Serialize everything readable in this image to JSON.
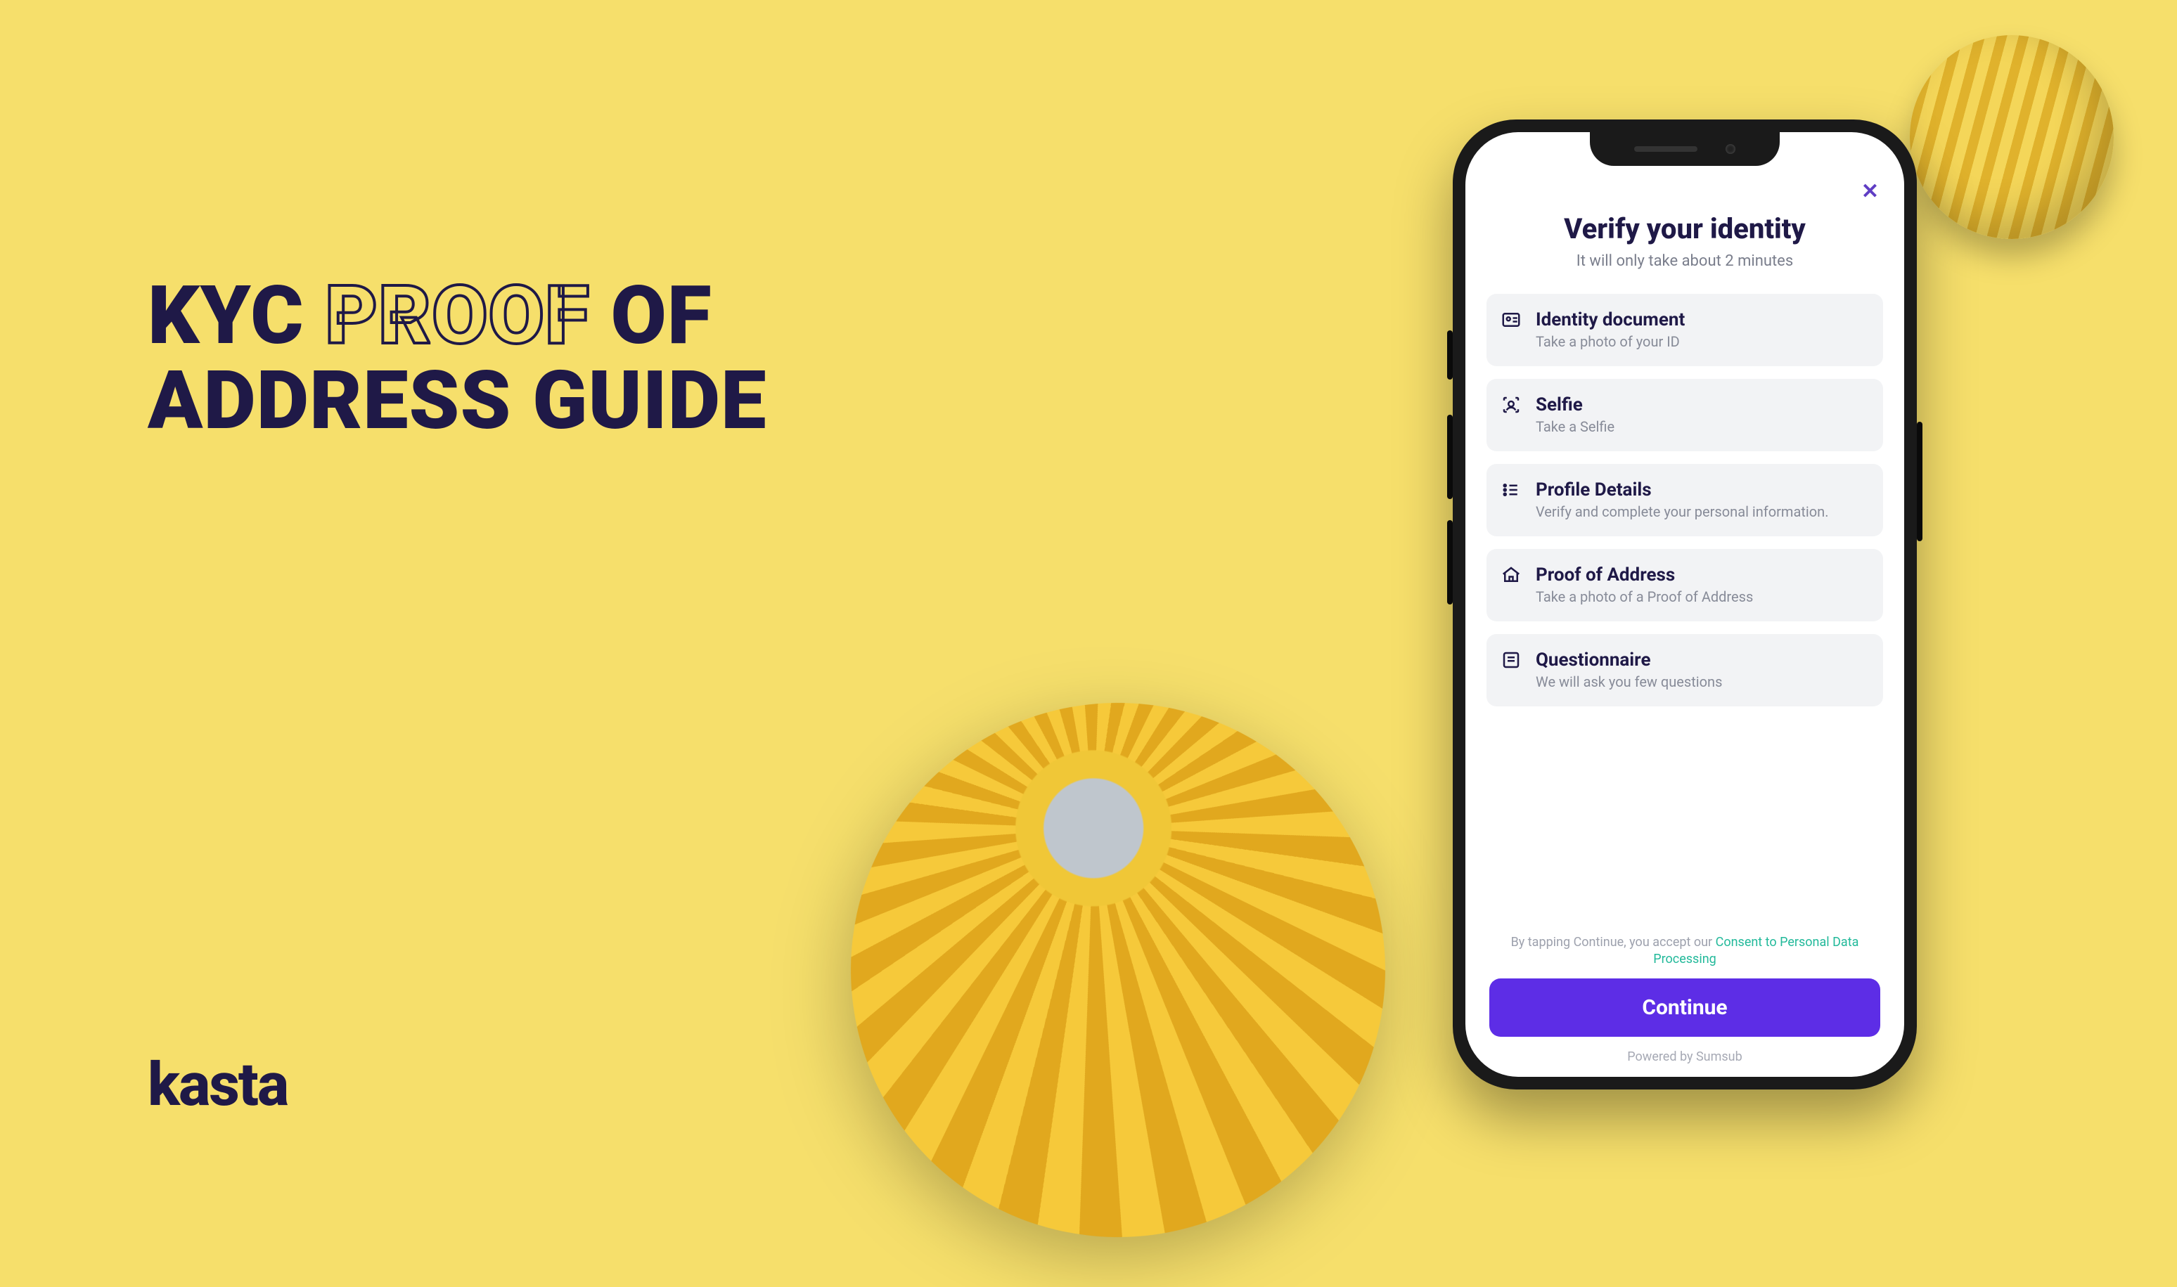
{
  "headline": {
    "w1": "KYC",
    "w2": "PROOF",
    "w3": "OF",
    "w4": "ADDRESS GUIDE"
  },
  "brand": "kasta",
  "phone": {
    "close_glyph": "✕",
    "title": "Verify your identity",
    "subtitle": "It will only take about 2 minutes",
    "steps": [
      {
        "title": "Identity document",
        "desc": "Take a photo of your ID"
      },
      {
        "title": "Selfie",
        "desc": "Take a Selfie"
      },
      {
        "title": "Profile Details",
        "desc": "Verify and complete your personal information."
      },
      {
        "title": "Proof of Address",
        "desc": "Take a photo of a Proof of Address"
      },
      {
        "title": "Questionnaire",
        "desc": "We will ask you few questions"
      }
    ],
    "consent_pre": "By tapping Continue, you accept our ",
    "consent_link": "Consent to Personal Data Processing",
    "continue_label": "Continue",
    "powered": "Powered by Sumsub"
  }
}
